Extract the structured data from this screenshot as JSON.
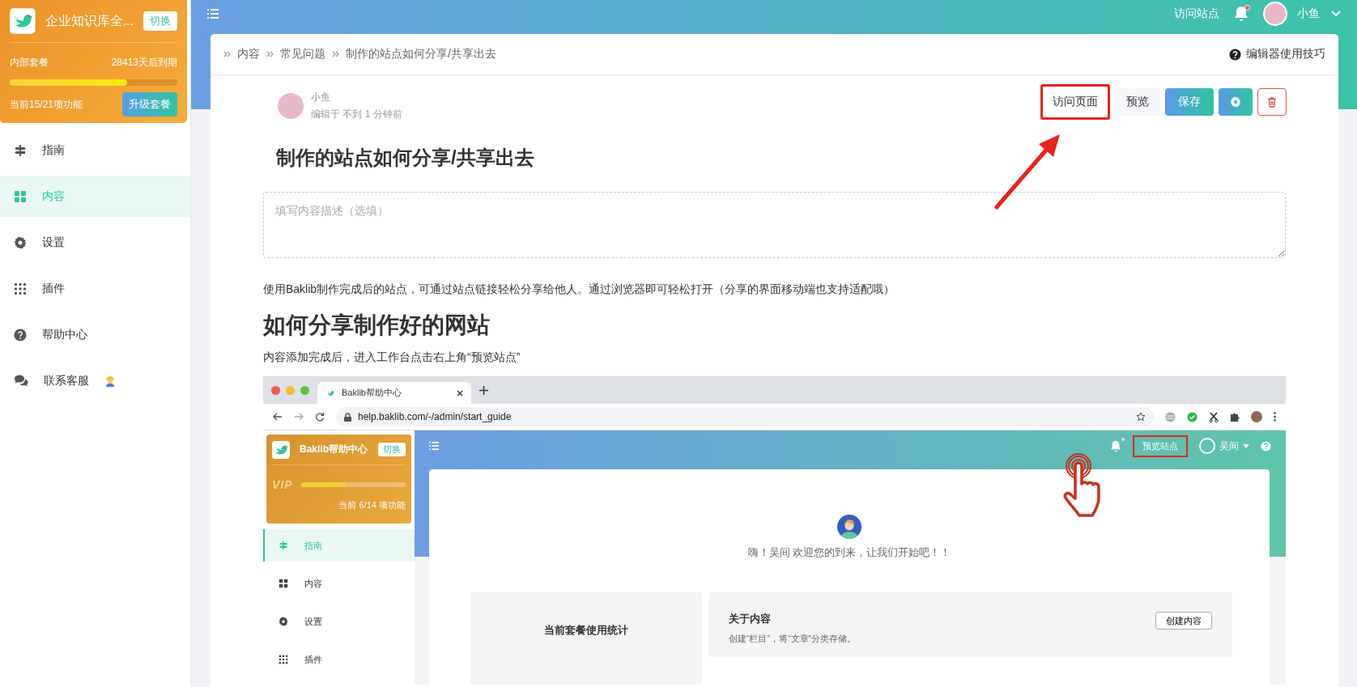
{
  "sidebar": {
    "workspace": {
      "name": "企业知识库全...",
      "switch": "切换",
      "plan": "内部套餐",
      "expiry": "28413天后到期",
      "level": 0.7,
      "usage": "当前15/21项功能",
      "upgrade": "升级套餐"
    },
    "items": [
      {
        "label": "指南",
        "kind": "guide",
        "selected": false
      },
      {
        "label": "内容",
        "kind": "content",
        "selected": true
      },
      {
        "label": "设置",
        "kind": "settings",
        "selected": false
      },
      {
        "label": "插件",
        "kind": "plugins",
        "selected": false
      },
      {
        "label": "帮助中心",
        "kind": "help",
        "selected": false
      },
      {
        "label": "联系客服",
        "kind": "contact",
        "selected": false
      }
    ]
  },
  "topbar": {
    "visit_site": "访问站点",
    "unread": true,
    "user": "小鱼"
  },
  "breadcrumb": [
    "内容",
    "常见问题",
    "制作的站点如何分享/共享出去"
  ],
  "editor_tips": "编辑器使用技巧",
  "author": {
    "name": "小鱼",
    "edited": "编辑于 不到 1 分钟前"
  },
  "actions": [
    {
      "kind": "visit",
      "label": "访问页面",
      "highlighted": true
    },
    {
      "kind": "preview",
      "label": "预览",
      "highlighted": false
    },
    {
      "kind": "save",
      "label": "保存",
      "highlighted": false
    },
    {
      "kind": "settings",
      "highlighted": false
    },
    {
      "kind": "delete",
      "highlighted": false
    }
  ],
  "title": "制作的站点如何分享/共享出去",
  "description": {
    "placeholder": "填写内容描述（选填）"
  },
  "body": [
    {
      "kind": "paragraph",
      "text": "使用Baklib制作完成后的站点，可通过站点链接轻松分享给他人。通过浏览器即可轻松打开（分享的界面移动端也支持适配哦）"
    },
    {
      "kind": "heading",
      "text": "如何分享制作好的网站"
    },
    {
      "kind": "paragraph",
      "text": "内容添加完成后，进入工作台点击右上角“预览站点”"
    },
    {
      "kind": "screenshot",
      "tab": "Baklib帮助中心",
      "url": "help.baklib.com/-/admin/start_guide",
      "workspace": {
        "name": "Baklib帮助中心",
        "switch": "切换",
        "badge": "VIP",
        "level": 0.43,
        "usage": "当前 6/14 项功能"
      },
      "items": [
        {
          "label": "指南",
          "kind": "guide",
          "selected": true
        },
        {
          "label": "内容",
          "kind": "content",
          "selected": false
        },
        {
          "label": "设置",
          "kind": "settings",
          "selected": false
        },
        {
          "label": "插件",
          "kind": "plugins",
          "selected": false
        }
      ],
      "topbar": {
        "unread": true,
        "preview": "预览站点",
        "preview_highlighted": true,
        "user": "吴间"
      },
      "greeting": "嗨！吴间 欢迎您的到来，让我们开始吧！！",
      "panels": [
        {
          "title": "当前套餐使用统计"
        },
        {
          "title": "关于内容",
          "text": "创建“栏目”，将“文章”分类存储。",
          "button": "创建内容"
        }
      ]
    }
  ]
}
